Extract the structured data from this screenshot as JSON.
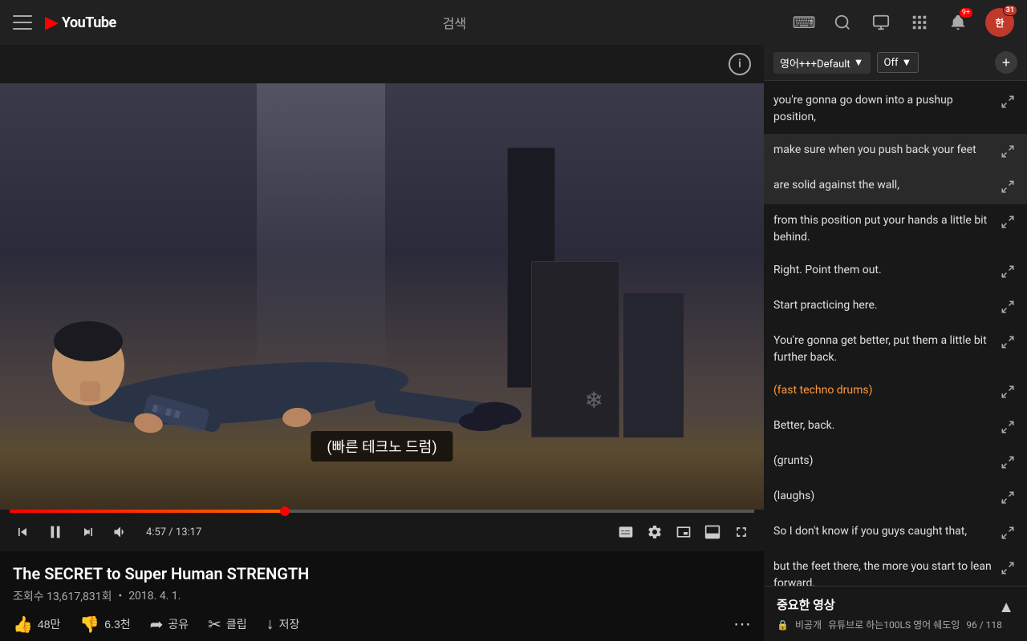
{
  "nav": {
    "hamburger_label": "Menu",
    "logo_icon": "▶",
    "logo_text": "YouTube",
    "search_text": "검색",
    "keyboard_icon": "⌨",
    "search_icon": "🔍",
    "cast_icon": "📺",
    "apps_icon": "⊞",
    "notif_icon": "🔔",
    "notif_badge": "9+",
    "avatar_text": "한",
    "avatar_badge": "31"
  },
  "video": {
    "subtitle": "(빠른 테크노 드럼)",
    "current_time": "4:57",
    "total_time": "13:17",
    "progress_percent": 37
  },
  "below_video": {
    "title": "The SECRET to Super Human STRENGTH",
    "views": "조회수 13,617,831회",
    "date": "2018. 4. 1.",
    "like_count": "48만",
    "dislike_count": "6.3천",
    "share_label": "공유",
    "save_label": "저장",
    "clip_label": "클립",
    "more_label": "..."
  },
  "caption_panel": {
    "language_label": "영어+++Default",
    "off_label": "Off",
    "add_label": "+",
    "items": [
      {
        "id": 1,
        "text": "you're gonna go down into a pushup position,",
        "music": false,
        "highlighted": false
      },
      {
        "id": 2,
        "text": "make sure when you push back your feet",
        "music": false,
        "highlighted": true
      },
      {
        "id": 3,
        "text": "are solid against the wall,",
        "music": false,
        "highlighted": true
      },
      {
        "id": 4,
        "text": "from this position put your hands a little bit behind.",
        "music": false,
        "highlighted": false
      },
      {
        "id": 5,
        "text": "Right. Point them out.",
        "music": false,
        "highlighted": false
      },
      {
        "id": 6,
        "text": "Start practicing here.",
        "music": false,
        "highlighted": false
      },
      {
        "id": 7,
        "text": "You're gonna get better, put them a little bit further back.",
        "music": false,
        "highlighted": false
      },
      {
        "id": 8,
        "text": "(fast techno drums)",
        "music": true,
        "highlighted": false
      },
      {
        "id": 9,
        "text": "Better, back.",
        "music": false,
        "highlighted": false
      },
      {
        "id": 10,
        "text": "(grunts)",
        "music": false,
        "highlighted": false
      },
      {
        "id": 11,
        "text": "(laughs)",
        "music": false,
        "highlighted": false
      },
      {
        "id": 12,
        "text": "So I don't know if you guys caught that,",
        "music": false,
        "highlighted": false
      },
      {
        "id": 13,
        "text": "but the feet there, the more you start to lean forward,",
        "music": false,
        "highlighted": false
      }
    ]
  },
  "important_section": {
    "title": "중요한 영상",
    "lock_icon": "🔒",
    "privacy": "비공개",
    "channel": "유튜브로 하는100LS 영어 쉐도잉",
    "count": "96 / 118",
    "chevron_icon": "▲"
  }
}
